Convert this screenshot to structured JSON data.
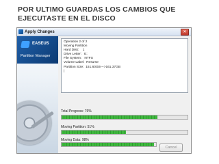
{
  "slide": {
    "title": "POR ULTIMO GUARDAS LOS CAMBIOS QUE EJECUTASTE EN EL DISCO"
  },
  "window": {
    "title": "Apply Changes",
    "close_glyph": "✕",
    "brand_name": "EASEUS",
    "product_name": "Partition Manager",
    "log_lines": [
      "Operation 2 of 2",
      "Moving Partition",
      "Hard Disk:    1",
      "Drive Letter:   E:",
      "File System:   NTFS",
      "Volume Label:  Resurse",
      "Partition Size:  151.60GB--->161.37GB",
      "|"
    ],
    "progress": [
      {
        "label": "Total Progress:  76%",
        "percent": 76
      },
      {
        "label": "Moving Partition:  51%",
        "percent": 51
      },
      {
        "label": "Moving Data:  98%",
        "percent": 98
      }
    ],
    "cancel_label": "Cancel"
  },
  "colors": {
    "progress_fill": "#3fb83f",
    "brand_header": "#1f5fa8"
  }
}
